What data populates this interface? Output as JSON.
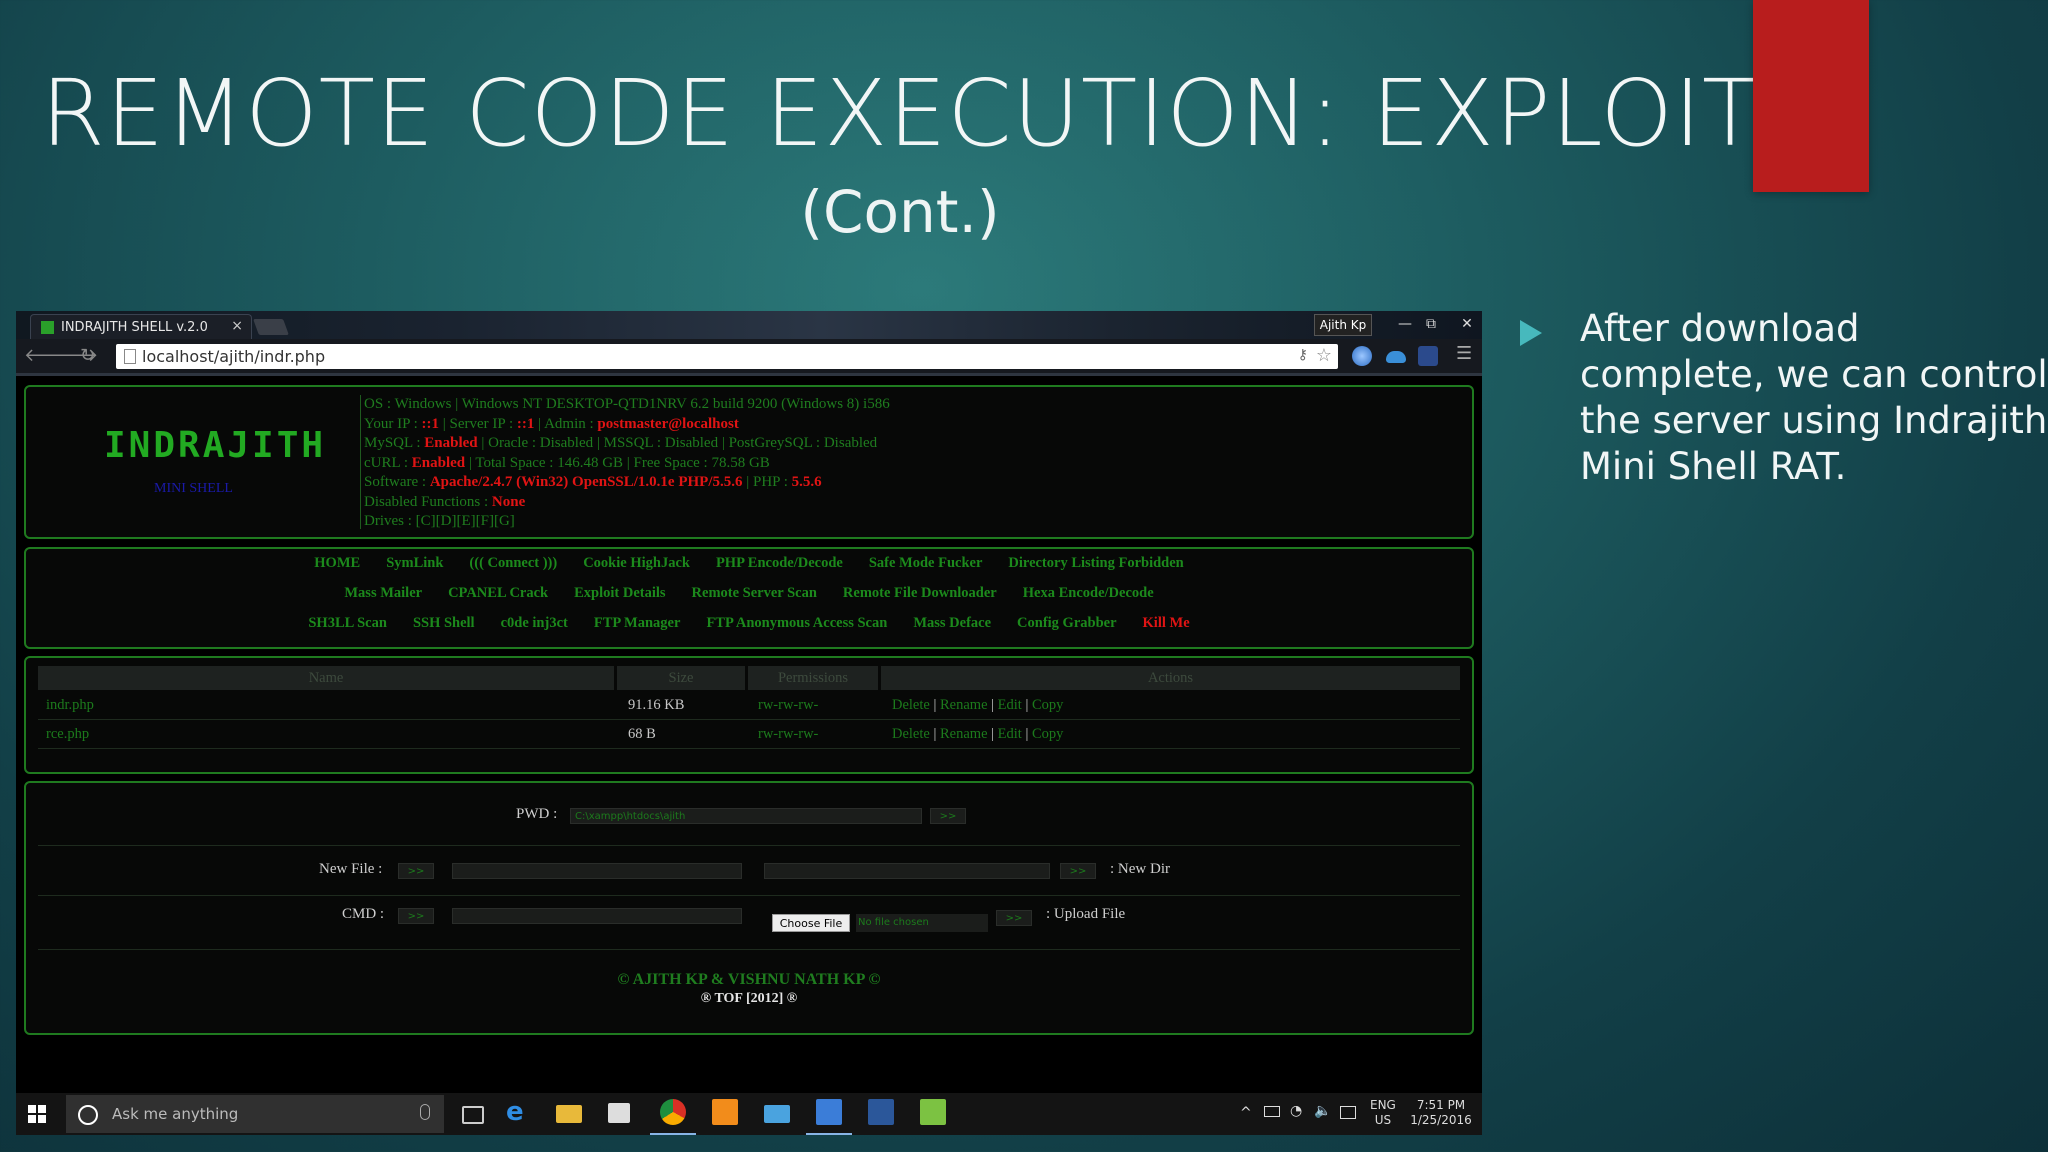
{
  "slide": {
    "title": "REMOTE CODE EXECUTION: EXPLOIT",
    "subtitle": "(Cont.)",
    "bullet": "After download complete, we can control the server using Indrajith Mini Shell RAT."
  },
  "browser": {
    "tab_title": "INDRAJITH SHELL v.2.0",
    "tab_close": "×",
    "user": "Ajith Kp",
    "url": "localhost/ajith/indr.php",
    "win_min": "—",
    "win_restore": "⧉",
    "win_close": "✕"
  },
  "shell": {
    "logo": "INDRAJITH",
    "logo_sub": "MINI SHELL",
    "info": {
      "os": "OS : Windows | Windows NT DESKTOP-QTD1NRV 6.2 build 9200 (Windows 8) i586",
      "ip_label": "Your IP : ",
      "your_ip": "::1",
      "server_ip_label": " | Server IP : ",
      "server_ip": "::1",
      "admin_label": " | Admin : ",
      "admin": "postmaster@localhost",
      "mysql_label": "MySQL : ",
      "mysql": "Enabled",
      "db_rest": " | Oracle : Disabled | MSSQL : Disabled | PostGreySQL : Disabled",
      "curl_label": "cURL : ",
      "curl": "Enabled",
      "space": " | Total Space : 146.48 GB | Free Space : 78.58 GB",
      "software_label": "Software : ",
      "software": "Apache/2.4.7 (Win32) OpenSSL/1.0.1e PHP/5.5.6",
      "php_label": " | PHP : ",
      "php": "5.5.6",
      "disabled_label": "Disabled Functions : ",
      "disabled": "None",
      "drives": "Drives : [C][D][E][F][G]"
    },
    "nav_rows": [
      [
        "HOME",
        "SymLink",
        "((( Connect )))",
        "Cookie HighJack",
        "PHP Encode/Decode",
        "Safe Mode Fucker",
        "Directory Listing Forbidden"
      ],
      [
        "Mass Mailer",
        "CPANEL Crack",
        "Exploit Details",
        "Remote Server Scan",
        "Remote File Downloader",
        "Hexa Encode/Decode"
      ],
      [
        "SH3LL Scan",
        "SSH Shell",
        "c0de inj3ct",
        "FTP Manager",
        "FTP Anonymous Access Scan",
        "Mass Deface",
        "Config Grabber",
        "Kill Me"
      ]
    ],
    "table": {
      "headers": [
        "Name",
        "Size",
        "Permissions",
        "Actions"
      ],
      "rows": [
        {
          "name": "indr.php",
          "size": "91.16 KB",
          "perms": "rw-rw-rw-"
        },
        {
          "name": "rce.php",
          "size": "68 B",
          "perms": "rw-rw-rw-"
        }
      ],
      "actions": [
        "Delete",
        "Rename",
        "Edit",
        "Copy"
      ],
      "sep": "|"
    },
    "form": {
      "pwd_label": "PWD :",
      "pwd_value": "C:\\xampp\\htdocs\\ajith",
      "go": ">>",
      "new_file_label": "New File :",
      "new_dir_label": ": New Dir",
      "cmd_label": "CMD :",
      "choose_file": "Choose File",
      "no_file": "No file chosen",
      "upload_label": ": Upload File"
    },
    "copyright1": "© AJITH KP & VISHNU NATH KP ©",
    "copyright2": "® TOF [2012] ®"
  },
  "taskbar": {
    "search_placeholder": "Ask me anything",
    "lang1": "ENG",
    "lang2": "US",
    "time": "7:51 PM",
    "date": "1/25/2016"
  },
  "colors": {
    "accent_teal": "#47b9bd",
    "red_block": "#b81d1d",
    "shell_green": "#1c8a1c",
    "shell_red": "#e01414"
  }
}
